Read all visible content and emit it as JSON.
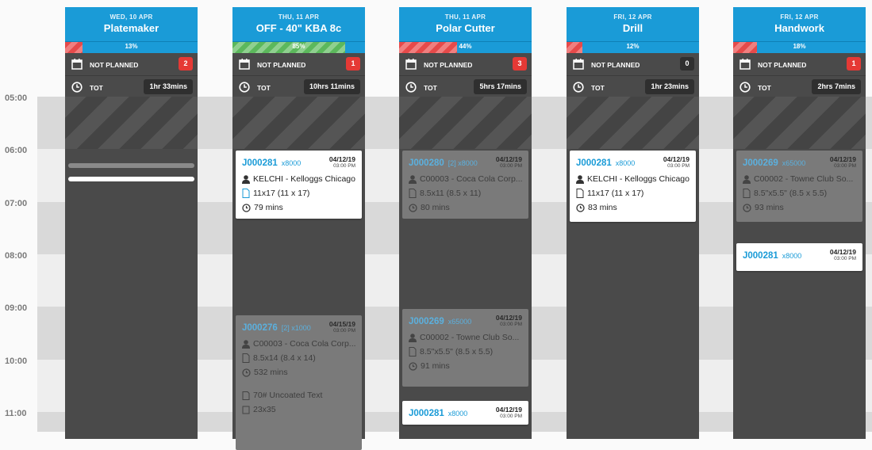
{
  "times": [
    "05:00",
    "06:00",
    "07:00",
    "08:00",
    "09:00",
    "10:00",
    "11:00"
  ],
  "columns": [
    {
      "date": "WED, 10 APR",
      "title": "Platemaker",
      "progress": "13%",
      "progress_fraction": 0.13,
      "progress_color": "red",
      "not_planned_label": "NOT PLANNED",
      "not_planned_count": "2",
      "tot_label": "TOT",
      "tot_value": "1hr 33mins",
      "cards": []
    },
    {
      "date": "THU, 11 APR",
      "title": "OFF - 40\" KBA 8c",
      "progress": "85%",
      "progress_fraction": 0.85,
      "progress_color": "green",
      "not_planned_label": "NOT PLANNED",
      "not_planned_count": "1",
      "tot_label": "TOT",
      "tot_value": "10hrs 11mins",
      "cards": [
        {
          "job": "J000281",
          "qty": "x8000",
          "date": "04/12/19",
          "time": "03:00 PM",
          "customer": "KELCHI - Kelloggs Chicago",
          "size": "11x17 (11 x 17)",
          "duration": "79 mins",
          "dim": false
        },
        {
          "job": "J000276",
          "qty": "[2] x1000",
          "date": "04/15/19",
          "time": "03:00 PM",
          "customer": "C00003 - Coca Cola Corp...",
          "size": "8.5x14 (8.4 x 14)",
          "duration": "532 mins",
          "stock": "70# Uncoated Text",
          "sheet": "23x35",
          "dim": true
        }
      ]
    },
    {
      "date": "THU, 11 APR",
      "title": "Polar Cutter",
      "progress": "44%",
      "progress_fraction": 0.44,
      "progress_color": "red",
      "not_planned_label": "NOT PLANNED",
      "not_planned_count": "3",
      "tot_label": "TOT",
      "tot_value": "5hrs 17mins",
      "cards": [
        {
          "job": "J000280",
          "qty": "[2] x8000",
          "date": "04/12/19",
          "time": "03:00 PM",
          "customer": "C00003 - Coca Cola Corp...",
          "size": "8.5x11 (8.5 x 11)",
          "duration": "80 mins",
          "dim": true
        },
        {
          "job": "J000269",
          "qty": "x65000",
          "date": "04/12/19",
          "time": "03:00 PM",
          "customer": "C00002 - Towne Club So...",
          "size": "8.5\"x5.5\" (8.5 x 5.5)",
          "duration": "91 mins",
          "dim": true
        },
        {
          "job": "J000281",
          "qty": "x8000",
          "date": "04/12/19",
          "time": "03:00 PM",
          "dim": false
        }
      ]
    },
    {
      "date": "FRI, 12 APR",
      "title": "Drill",
      "progress": "12%",
      "progress_fraction": 0.12,
      "progress_color": "red",
      "not_planned_label": "NOT PLANNED",
      "not_planned_count": "0",
      "tot_label": "TOT",
      "tot_value": "1hr 23mins",
      "cards": [
        {
          "job": "J000281",
          "qty": "x8000",
          "date": "04/12/19",
          "time": "03:00 PM",
          "customer": "KELCHI - Kelloggs Chicago",
          "size": "11x17 (11 x 17)",
          "duration": "83 mins",
          "dim": false
        }
      ]
    },
    {
      "date": "FRI, 12 APR",
      "title": "Handwork",
      "progress": "18%",
      "progress_fraction": 0.18,
      "progress_color": "red",
      "not_planned_label": "NOT PLANNED",
      "not_planned_count": "1",
      "tot_label": "TOT",
      "tot_value": "2hrs 7mins",
      "cards": [
        {
          "job": "J000269",
          "qty": "x65000",
          "date": "04/12/19",
          "time": "03:00 PM",
          "customer": "C00002 - Towne Club So...",
          "size": "8.5\"x5.5\" (8.5 x 5.5)",
          "duration": "93 mins",
          "dim": true
        },
        {
          "job": "J000281",
          "qty": "x8000",
          "date": "04/12/19",
          "time": "03:00 PM",
          "dim": false
        }
      ]
    }
  ]
}
